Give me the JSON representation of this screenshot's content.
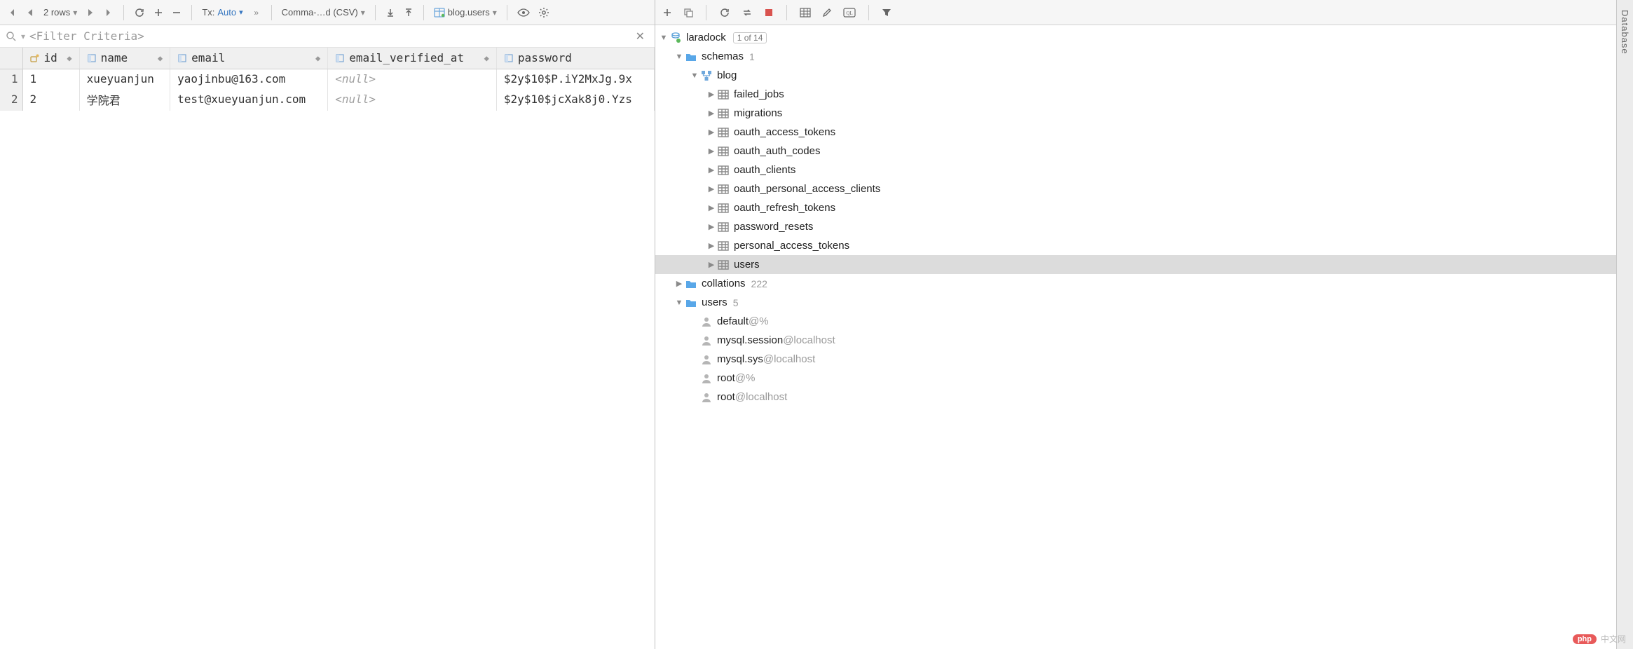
{
  "toolbar": {
    "rows_text": "2 rows",
    "tx_label": "Tx:",
    "tx_value": "Auto",
    "format": "Comma-…d (CSV)",
    "table_ref": "blog.users"
  },
  "filter": {
    "placeholder": "<Filter Criteria>"
  },
  "columns": [
    {
      "name": "id",
      "type": "pk"
    },
    {
      "name": "name",
      "type": "col"
    },
    {
      "name": "email",
      "type": "col"
    },
    {
      "name": "email_verified_at",
      "type": "col"
    },
    {
      "name": "password",
      "type": "col"
    }
  ],
  "rows": [
    {
      "n": "1",
      "id": "1",
      "name": "xueyuanjun",
      "email": "yaojinbu@163.com",
      "email_verified_at": null,
      "password": "$2y$10$P.iY2MxJg.9x"
    },
    {
      "n": "2",
      "id": "2",
      "name": "学院君",
      "email": "test@xueyuanjun.com",
      "email_verified_at": null,
      "password": "$2y$10$jcXak8j0.Yzs"
    }
  ],
  "tree": {
    "datasource": {
      "name": "laradock",
      "badge": "1 of 14"
    },
    "schemas_group": {
      "label": "schemas",
      "count": "1"
    },
    "db": "blog",
    "tables": [
      "failed_jobs",
      "migrations",
      "oauth_access_tokens",
      "oauth_auth_codes",
      "oauth_clients",
      "oauth_personal_access_clients",
      "oauth_refresh_tokens",
      "password_resets",
      "personal_access_tokens",
      "users"
    ],
    "selected_table": "users",
    "collations": {
      "label": "collations",
      "count": "222"
    },
    "users_group": {
      "label": "users",
      "count": "5"
    },
    "db_users": [
      {
        "name": "default",
        "host": "@%"
      },
      {
        "name": "mysql.session",
        "host": "@localhost"
      },
      {
        "name": "mysql.sys",
        "host": "@localhost"
      },
      {
        "name": "root",
        "host": "@%"
      },
      {
        "name": "root",
        "host": "@localhost"
      }
    ]
  },
  "sidebar_tab": "Database",
  "watermark": "中文网"
}
